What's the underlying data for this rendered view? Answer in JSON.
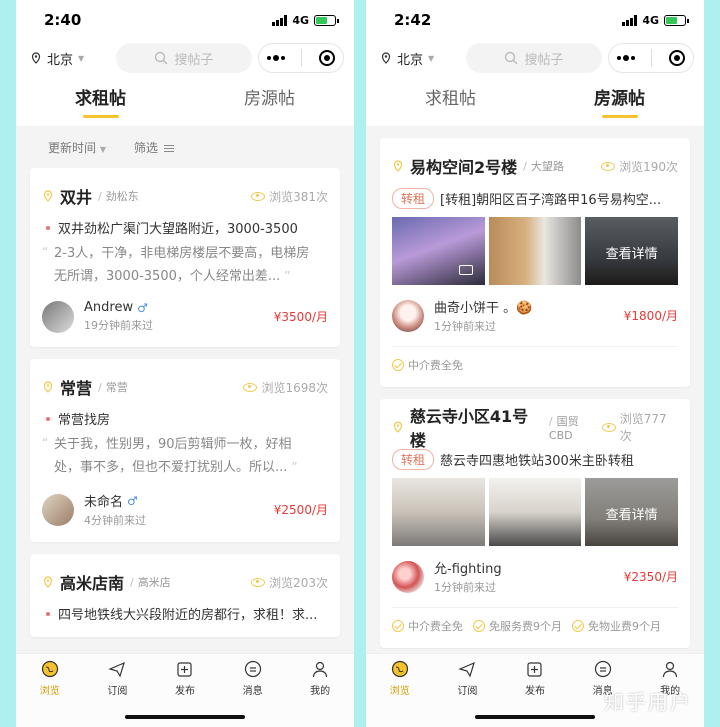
{
  "left": {
    "status": {
      "time": "2:40",
      "network": "4G"
    },
    "nav": {
      "city": "北京",
      "search_placeholder": "搜帖子"
    },
    "tabs": [
      "求租帖",
      "房源帖"
    ],
    "filters": {
      "sort": "更新时间",
      "filter": "筛选"
    },
    "posts": [
      {
        "title": "双井",
        "area": "劲松东",
        "views": "浏览381次",
        "summary": "双井劲松广渠门大望路附近，3000-3500",
        "quote": "2-3人，干净，非电梯房楼层不要高，电梯房无所谓，3000-3500，个人经常出差...",
        "user": "Andrew",
        "gender": "♂",
        "time": "19分钟前来过",
        "price": "¥3500/月"
      },
      {
        "title": "常营",
        "area": "常营",
        "views": "浏览1698次",
        "summary": "常营找房",
        "quote": "关于我，性别男，90后剪辑师一枚，好相处，事不多，但也不爱打扰别人。所以...",
        "user": "未命名",
        "gender": "♂",
        "time": "4分钟前来过",
        "price": "¥2500/月"
      },
      {
        "title": "高米店南",
        "area": "高米店",
        "views": "浏览203次",
        "summary": "四号地铁线大兴段附近的房都行，求租！求..."
      }
    ]
  },
  "right": {
    "status": {
      "time": "2:42",
      "network": "4G"
    },
    "nav": {
      "city": "北京",
      "search_placeholder": "搜帖子"
    },
    "tabs": [
      "求租帖",
      "房源帖"
    ],
    "listings": [
      {
        "title": "易构空间2号楼",
        "area": "大望路",
        "views": "浏览190次",
        "tag": "转租",
        "desc": "[转租]朝阳区百子湾路甲16号易构空...",
        "more_label": "查看详情",
        "user": "曲奇小饼干 。🍪",
        "time": "1分钟前来过",
        "price": "¥1800/月",
        "perks": [
          "中介费全免"
        ]
      },
      {
        "title": "慈云寺小区41号楼",
        "area": "国贸CBD",
        "views": "浏览777次",
        "tag": "转租",
        "desc": "慈云寺四惠地铁站300米主卧转租",
        "more_label": "查看详情",
        "user": "允-fighting",
        "time": "1分钟前来过",
        "price": "¥2350/月",
        "perks": [
          "中介费全免",
          "免服务费9个月",
          "免物业费9个月"
        ]
      }
    ]
  },
  "tabbar": [
    "浏览",
    "订阅",
    "发布",
    "消息",
    "我的"
  ],
  "watermark": "知乎用户",
  "colors": {
    "accent": "#f6c32e",
    "price": "#e53935",
    "tag": "#e2735a"
  }
}
